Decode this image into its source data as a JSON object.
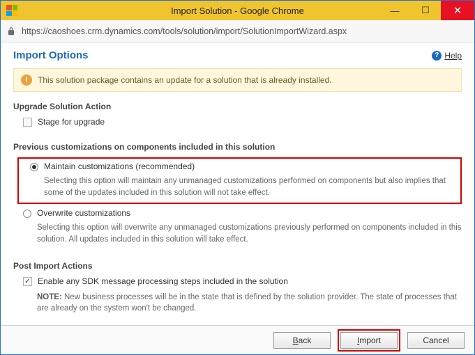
{
  "window": {
    "title": "Import Solution - Google Chrome"
  },
  "address": {
    "url": "https://caoshoes.crm.dynamics.com/tools/solution/import/SolutionImportWizard.aspx"
  },
  "header": {
    "heading": "Import Options",
    "help_label": "Help"
  },
  "banner": {
    "text": "This solution package contains an update for a solution that is already installed."
  },
  "upgrade": {
    "section_title": "Upgrade Solution Action",
    "stage_label": "Stage for upgrade"
  },
  "customizations": {
    "section_title": "Previous customizations on components included in this solution",
    "maintain": {
      "label": "Maintain customizations (recommended)",
      "desc": "Selecting this option will maintain any unmanaged customizations performed on components but also implies that some of the updates included in this solution will not take effect."
    },
    "overwrite": {
      "label": "Overwrite customizations",
      "desc": "Selecting this option will overwrite any unmanaged customizations previously performed on components included in this solution. All updates included in this solution will take effect."
    }
  },
  "post_import": {
    "section_title": "Post Import Actions",
    "enable_sdk_label": "Enable any SDK message processing steps included in the solution",
    "note_prefix": "NOTE:",
    "note_text": " New business processes will be in the state that is defined by the solution provider. The state of processes that are already on the system won't be changed."
  },
  "buttons": {
    "back": "Back",
    "import": "Import",
    "cancel": "Cancel"
  }
}
